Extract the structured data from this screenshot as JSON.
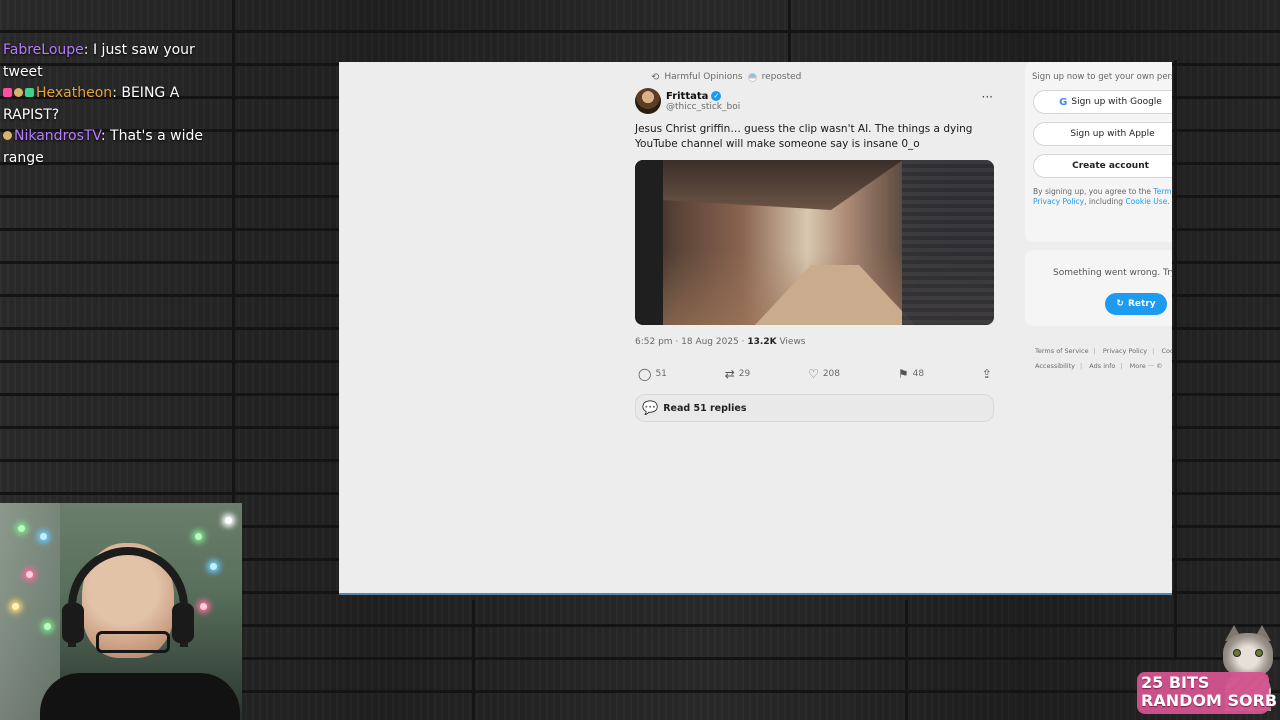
{
  "chat": {
    "messages": [
      {
        "user": "FabreLoupe",
        "user_color": "#b77cff",
        "badges": [],
        "text": "I just saw your tweet"
      },
      {
        "user": "Hexatheon",
        "user_color": "#e8a33c",
        "badges": [
          "#ff4fa3",
          "#d8b46a",
          "#3fcf8e"
        ],
        "text": "BEING A RAPIST?"
      },
      {
        "user": "NikandrosTV",
        "user_color": "#b77cff",
        "badges": [
          "#d8b46a"
        ],
        "text": "That's a wide range"
      }
    ]
  },
  "tweet": {
    "repost_line": "Harmful Opinions",
    "repost_suffix": "reposted",
    "author_name": "Frittata",
    "author_handle": "@thicc_stick_boi",
    "more_icon": "more-horizontal-icon",
    "text": "Jesus Christ griffin… guess the clip wasn't AI. The things a dying YouTube channel will make someone say is insane 0_o",
    "timestamp": "6:52 pm · 18 Aug 2025 ·",
    "views_count": "13.2K",
    "views_label": "Views",
    "actions": {
      "replies": "51",
      "reposts": "29",
      "likes": "208",
      "bookmarks": "48"
    },
    "read_replies_label": "Read 51 replies"
  },
  "sidebar": {
    "signup_title": "Sign up now to get your own personal",
    "google_label": "Sign up with Google",
    "apple_label": "Sign up with Apple",
    "create_label": "Create account",
    "terms_line1_prefix": "By signing up, you agree to the",
    "terms_line1_link": "Terms",
    "terms_line2_link1": "Privacy Policy",
    "terms_line2_mid": ", including",
    "terms_line2_link2": "Cookie Use.",
    "error_text": "Something went wrong. Try",
    "retry_label": "Retry",
    "footer": {
      "terms": "Terms of Service",
      "privacy": "Privacy Policy",
      "cookie": "Coo",
      "accessibility": "Accessibility",
      "ads": "Ads info",
      "more": "More ···",
      "copyright": "©"
    }
  },
  "alert": {
    "line1": "25 BITS",
    "line2": "RANDOM SORB"
  }
}
